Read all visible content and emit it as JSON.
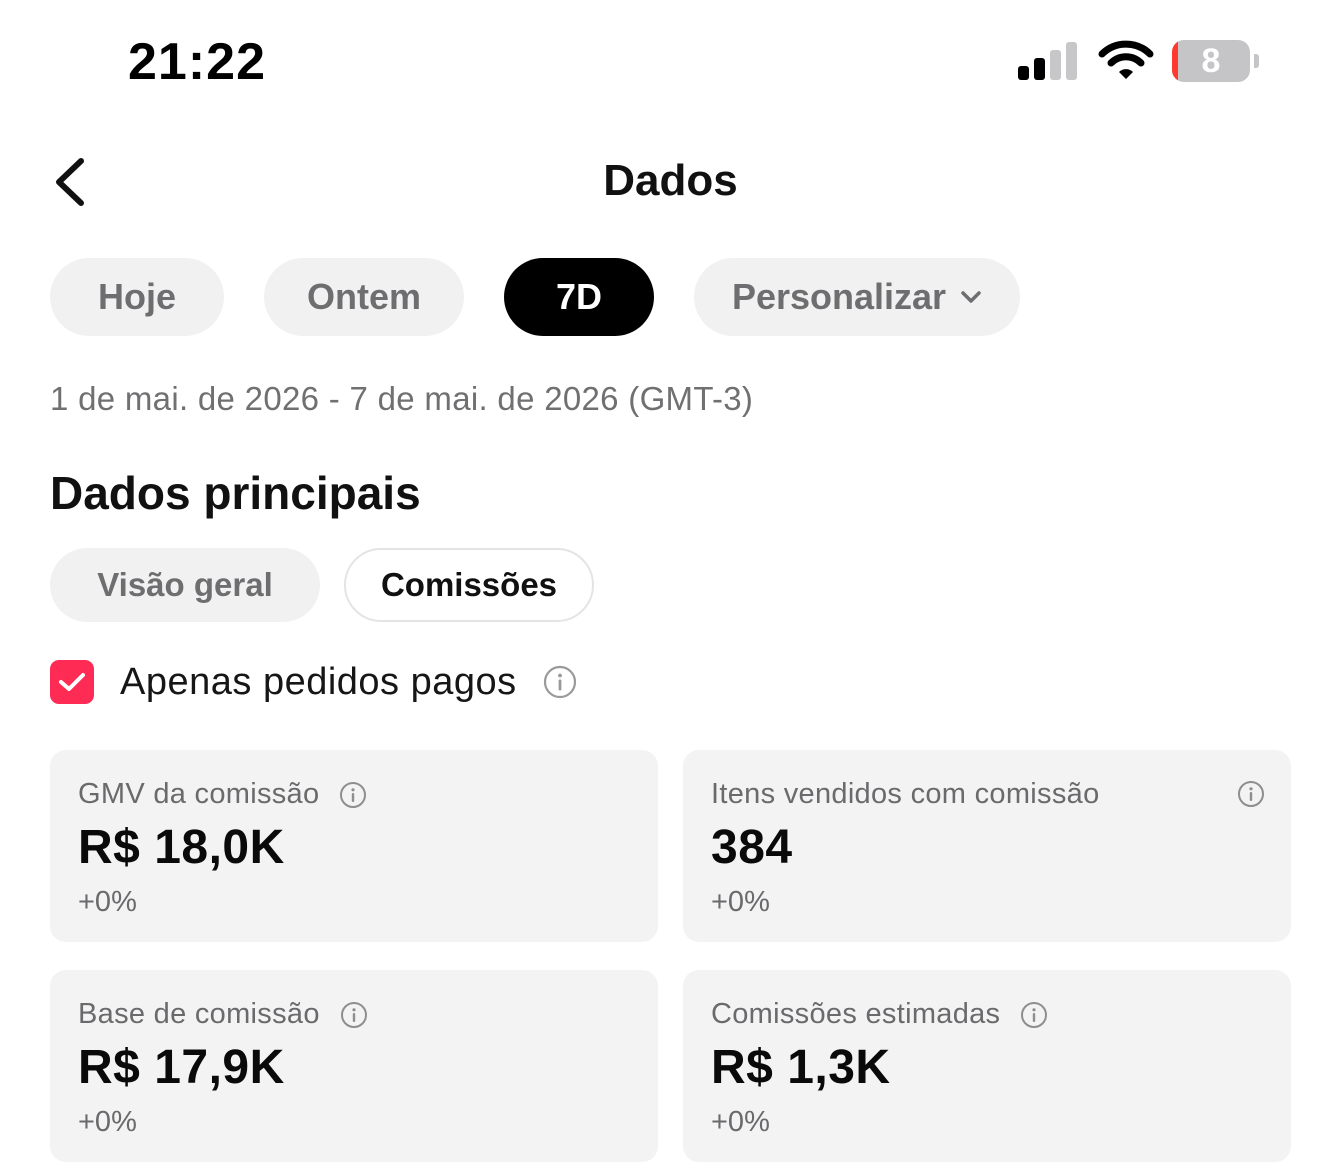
{
  "status_bar": {
    "time": "21:22",
    "battery_level": "8",
    "icons": [
      "cellular-signal-icon",
      "wifi-icon",
      "battery-icon"
    ]
  },
  "header": {
    "title": "Dados",
    "back_icon": "chevron-left-icon"
  },
  "period_filters": {
    "items": [
      {
        "label": "Hoje",
        "active": false
      },
      {
        "label": "Ontem",
        "active": false
      },
      {
        "label": "7D",
        "active": true
      },
      {
        "label": "Personalizar",
        "active": false,
        "icon": "chevron-down-icon"
      }
    ]
  },
  "date_range": "1 de mai. de 2026 - 7 de mai. de 2026 (GMT-3)",
  "main": {
    "section_title": "Dados principais",
    "tabs": [
      {
        "label": "Visão geral",
        "active": false
      },
      {
        "label": "Comissões",
        "active": true
      }
    ],
    "paid_only": {
      "label": "Apenas pedidos pagos",
      "checked": true
    },
    "metrics": [
      {
        "label": "GMV da comissão",
        "value": "R$ 18,0K",
        "change": "+0%"
      },
      {
        "label": "Itens vendidos com comissão",
        "value": "384",
        "change": "+0%"
      },
      {
        "label": "Base de comissão",
        "value": "R$ 17,9K",
        "change": "+0%"
      },
      {
        "label": "Comissões estimadas",
        "value": "R$ 1,3K",
        "change": "+0%"
      }
    ]
  },
  "colors": {
    "accent": "#fe2c55",
    "active_pill": "#000000",
    "pill_bg": "#f1f1f2",
    "card_bg": "#f3f3f4",
    "battery_low": "#ff3b30"
  }
}
